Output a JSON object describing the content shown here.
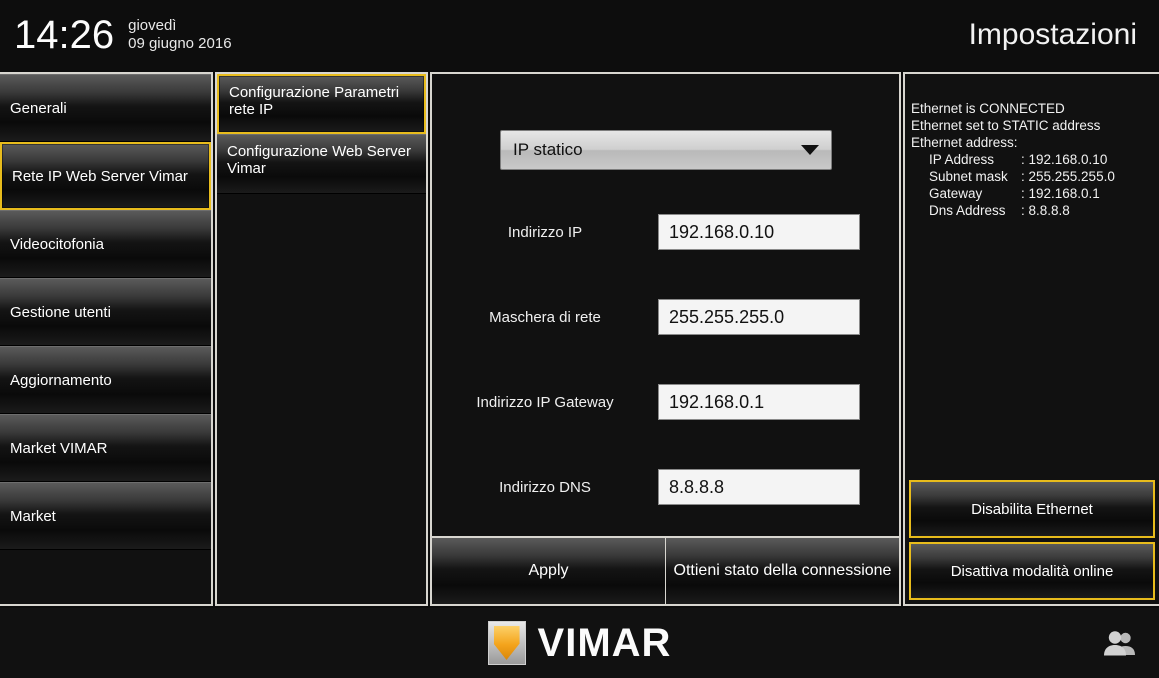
{
  "header": {
    "time": "14:26",
    "weekday": "giovedì",
    "date": "09 giugno 2016",
    "title": "Impostazioni"
  },
  "sidebar": {
    "items": [
      {
        "label": "Generali",
        "selected": false
      },
      {
        "label": "Rete IP Web Server Vimar",
        "selected": true
      },
      {
        "label": "Videocitofonia",
        "selected": false
      },
      {
        "label": "Gestione utenti",
        "selected": false
      },
      {
        "label": "Aggiornamento",
        "selected": false
      },
      {
        "label": "Market VIMAR",
        "selected": false
      },
      {
        "label": "Market",
        "selected": false
      }
    ]
  },
  "submenu": {
    "items": [
      {
        "label": "Configurazione Parametri rete IP",
        "selected": true
      },
      {
        "label": "Configurazione Web Server Vimar",
        "selected": false
      }
    ]
  },
  "main": {
    "mode_select": {
      "value": "IP statico",
      "icon": "chevron-down-icon"
    },
    "fields": [
      {
        "label": "Indirizzo IP",
        "value": "192.168.0.10"
      },
      {
        "label": "Maschera di rete",
        "value": "255.255.255.0"
      },
      {
        "label": "Indirizzo IP Gateway",
        "value": "192.168.0.1"
      },
      {
        "label": "Indirizzo DNS",
        "value": "8.8.8.8"
      }
    ],
    "actions": [
      {
        "label": "Apply"
      },
      {
        "label": "Ottieni stato della connessione"
      }
    ]
  },
  "status": {
    "lines": [
      "Ethernet is CONNECTED",
      "Ethernet set to STATIC address",
      "Ethernet address:"
    ],
    "details": [
      {
        "key": "IP Address",
        "value": ": 192.168.0.10"
      },
      {
        "key": "Subnet mask",
        "value": ": 255.255.255.0"
      },
      {
        "key": "Gateway",
        "value": ": 192.168.0.1"
      },
      {
        "key": "Dns Address",
        "value": ": 8.8.8.8"
      }
    ],
    "buttons": [
      {
        "label": "Disabilita Ethernet"
      },
      {
        "label": "Disattiva modalità online"
      }
    ]
  },
  "footer": {
    "brand": "VIMAR",
    "users_icon": "users-icon"
  },
  "colors": {
    "accent_yellow": "#e8bc1c",
    "panel_border": "#d8d6d0",
    "background": "#0c0c0c",
    "logo_gold": "#f4a41c"
  }
}
